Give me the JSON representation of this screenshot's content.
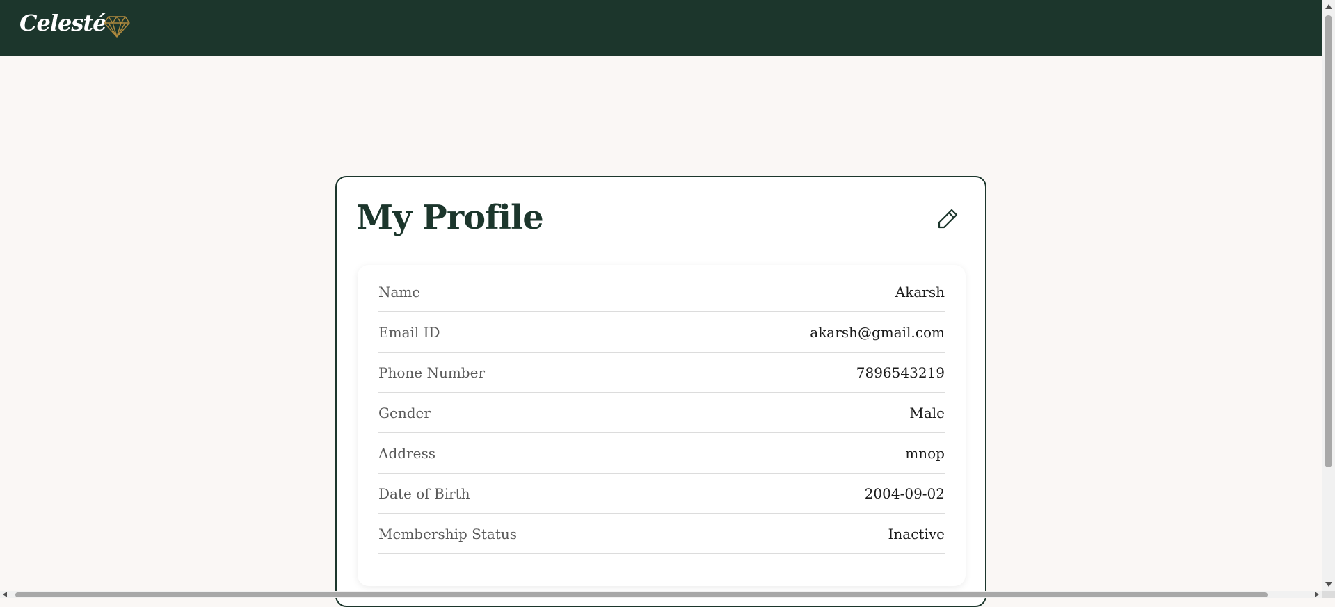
{
  "header": {
    "brand": "Celesté",
    "logo_icon": "diamond-icon",
    "background": "#1c362c",
    "accent": "#b08a3e"
  },
  "profile": {
    "title": "My Profile",
    "edit_icon": "pencil-icon",
    "fields": [
      {
        "label": "Name",
        "value": "Akarsh"
      },
      {
        "label": "Email ID",
        "value": "akarsh@gmail.com"
      },
      {
        "label": "Phone Number",
        "value": "7896543219"
      },
      {
        "label": "Gender",
        "value": "Male"
      },
      {
        "label": "Address",
        "value": "mnop"
      },
      {
        "label": "Date of Birth",
        "value": "2004-09-02"
      },
      {
        "label": "Membership Status",
        "value": "Inactive"
      }
    ]
  }
}
